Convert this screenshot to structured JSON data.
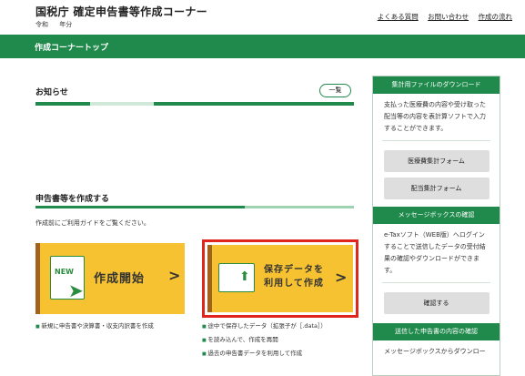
{
  "header": {
    "site_title": "国税庁  確定申告書等作成コーナー",
    "era_label": "令和",
    "year_label": "年分",
    "links": [
      "よくある質問",
      "お問い合わせ",
      "作成の流れ"
    ]
  },
  "nav": {
    "title": "作成コーナートップ"
  },
  "notice": {
    "heading": "お知らせ",
    "list_button": "一覧"
  },
  "create": {
    "heading": "申告書等を作成する",
    "pre_note": "作成前にご利用ガイドをご覧ください。",
    "start_card": {
      "badge": "NEW",
      "label": "作成開始",
      "arrow": ">"
    },
    "save_card": {
      "line1": "保存データを",
      "line2": "利用して作成",
      "arrow": ">"
    },
    "start_bullets": [
      "新規に申告書や決算書・収支内訳書を作成"
    ],
    "save_bullets": [
      "途中で保存したデータ（拡張子が［.data］）",
      "を読み込んで、作成を再開",
      "過去の申告書データを利用して作成"
    ]
  },
  "sidebar": {
    "download": {
      "heading": "集計用ファイルのダウンロード",
      "text": "支払った医療費の内容や受け取った配当等の内容を表計算ソフトで入力することができます。",
      "btn_medical": "医療費集計フォーム",
      "btn_dividend": "配当集計フォーム"
    },
    "messagebox": {
      "heading": "メッセージボックスの確認",
      "text": "e-Taxソフト（WEB版）へログインすることで送信したデータの受付結果の確認やダウンロードができます。",
      "btn_confirm": "確認する"
    },
    "sent": {
      "heading": "送信した申告書の内容の確認",
      "text": "メッセージボックスからダウンロー"
    }
  },
  "colors": {
    "brand_green": "#1f8a4c",
    "card_yellow": "#f6c231",
    "highlight_red": "#e0251f"
  }
}
